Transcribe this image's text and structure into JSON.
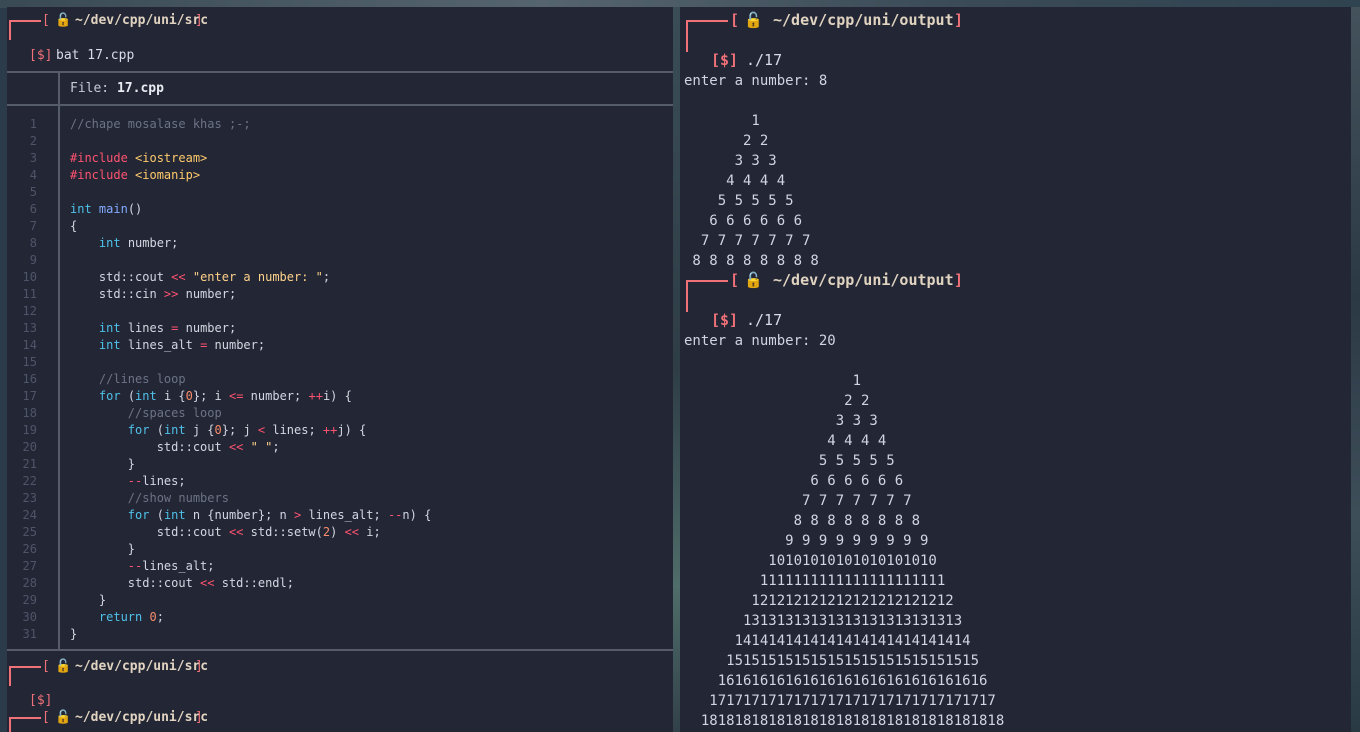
{
  "left": {
    "prompt1": {
      "path": "~/dev/cpp/uni/src",
      "command": "bat 17.cpp"
    },
    "file_label": "File:",
    "file_name": "17.cpp",
    "code_lines": [
      "//chape mosalase khas ;-;",
      "",
      "#include <iostream>",
      "#include <iomanip>",
      "",
      "int main()",
      "{",
      "    int number;",
      "",
      "    std::cout << \"enter a number: \";",
      "    std::cin >> number;",
      "",
      "    int lines = number;",
      "    int lines_alt = number;",
      "",
      "    //lines loop",
      "    for (int i {0}; i <= number; ++i) {",
      "        //spaces loop",
      "        for (int j {0}; j < lines; ++j) {",
      "            std::cout << \" \";",
      "        }",
      "        --lines;",
      "        //show numbers",
      "        for (int n {number}; n > lines_alt; --n) {",
      "            std::cout << std::setw(2) << i;",
      "        }",
      "        --lines_alt;",
      "        std::cout << std::endl;",
      "    }",
      "    return 0;",
      "}"
    ],
    "prompt2": {
      "path": "~/dev/cpp/uni/src",
      "command": ""
    },
    "prompt3": {
      "path": "~/dev/cpp/uni/src"
    }
  },
  "right": {
    "run1": {
      "path": "~/dev/cpp/uni/output",
      "command": "./17",
      "question": "enter a number: 8",
      "output": [
        "        1",
        "       2 2",
        "      3 3 3",
        "     4 4 4 4",
        "    5 5 5 5 5",
        "   6 6 6 6 6 6",
        "  7 7 7 7 7 7 7",
        " 8 8 8 8 8 8 8 8"
      ]
    },
    "run2": {
      "path": "~/dev/cpp/uni/output",
      "command": "./17",
      "question": "enter a number: 20",
      "output": [
        "                    1",
        "                   2 2",
        "                  3 3 3",
        "                 4 4 4 4",
        "                5 5 5 5 5",
        "               6 6 6 6 6 6",
        "              7 7 7 7 7 7 7",
        "             8 8 8 8 8 8 8 8",
        "            9 9 9 9 9 9 9 9 9",
        "          10101010101010101010",
        "         1111111111111111111111",
        "        121212121212121212121212",
        "       13131313131313131313131313",
        "      1414141414141414141414141414",
        "     151515151515151515151515151515",
        "    16161616161616161616161616161616",
        "   1717171717171717171717171717171717",
        "  181818181818181818181818181818181818"
      ]
    }
  },
  "prompt_symbol": "[$]",
  "colors": {
    "accent": "#f07178",
    "terminal_bg": "#232635"
  }
}
